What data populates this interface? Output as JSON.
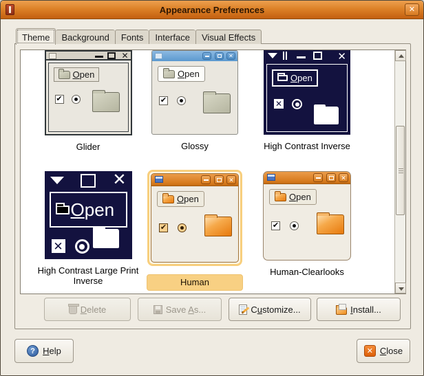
{
  "window": {
    "title": "Appearance Preferences"
  },
  "tabs": [
    "Theme",
    "Background",
    "Fonts",
    "Interface",
    "Visual Effects"
  ],
  "active_tab": "Theme",
  "theme_list": {
    "selected": "Human",
    "items": [
      {
        "name": "Glider"
      },
      {
        "name": "Glossy"
      },
      {
        "name": "High Contrast Inverse"
      },
      {
        "name": "High Contrast Large Print Inverse"
      },
      {
        "name": "Human"
      },
      {
        "name": "Human-Clearlooks"
      }
    ],
    "preview_open": {
      "key": "O",
      "post": "pen"
    }
  },
  "actions": {
    "delete": {
      "pre": "",
      "key": "D",
      "post": "elete",
      "enabled": false
    },
    "save_as": {
      "pre": "Save ",
      "key": "A",
      "post": "s...",
      "enabled": false
    },
    "customize": {
      "pre": "C",
      "key": "u",
      "post": "stomize...",
      "enabled": true
    },
    "install": {
      "pre": "",
      "key": "I",
      "post": "nstall...",
      "enabled": true
    }
  },
  "footer": {
    "help": {
      "key": "H",
      "post": "elp"
    },
    "close": {
      "key": "C",
      "post": "lose"
    }
  },
  "icons": {
    "x": "✕",
    "check": "✔",
    "question": "?"
  },
  "colors": {
    "titlebar_top": "#eda04f",
    "titlebar_bottom": "#c35f10",
    "selection_highlight": "#f8d083",
    "hc_navy": "#13123f",
    "glossy_blue": "#6ba4d6",
    "human_orange": "#e87d12",
    "dialog_bg": "#efebe2",
    "list_bg": "#ffffff"
  }
}
